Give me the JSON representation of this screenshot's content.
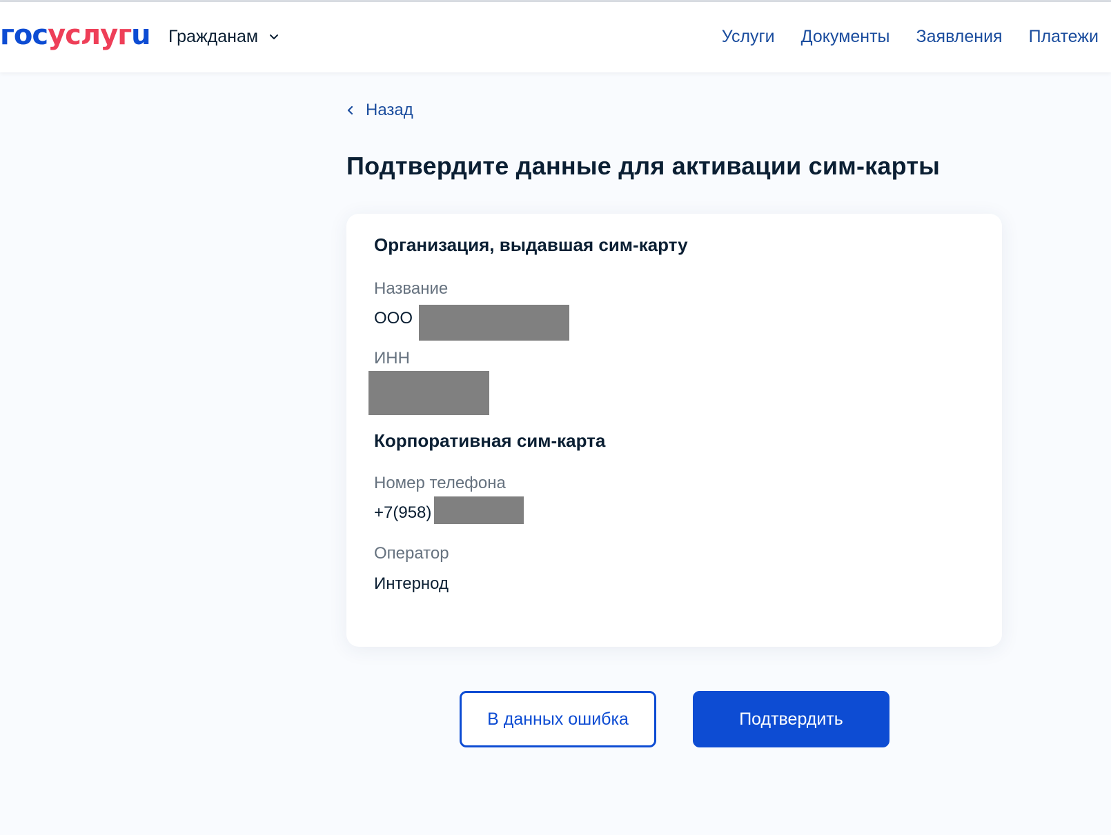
{
  "header": {
    "logo": {
      "part1": "гос",
      "part2": "услуг",
      "part3": "u"
    },
    "audience_menu": {
      "label": "Гражданам"
    },
    "nav": [
      {
        "label": "Услуги"
      },
      {
        "label": "Документы"
      },
      {
        "label": "Заявления"
      },
      {
        "label": "Платежи"
      }
    ]
  },
  "back_link": {
    "label": "Назад"
  },
  "page_title": "Подтвердите данные для активации сим-карты",
  "card": {
    "org_section": {
      "title": "Организация, выдавшая сим-карту",
      "name_label": "Название",
      "name_value": "ООО",
      "inn_label": "ИНН",
      "inn_value": ""
    },
    "sim_section": {
      "title": "Корпоративная сим-карта",
      "phone_label": "Номер телефона",
      "phone_value": "+7(958)",
      "operator_label": "Оператор",
      "operator_value": "Интернод"
    }
  },
  "actions": {
    "secondary_label": "В данных ошибка",
    "primary_label": "Подтвердить"
  },
  "colors": {
    "accent": "#0d4cd3",
    "logo_red": "#ee3f58",
    "text_primary": "#0b1f33",
    "text_secondary": "#66727f",
    "page_background": "#f9fbfe"
  },
  "icons": {
    "audience_menu": "chevron-down-icon",
    "back": "chevron-left-icon"
  }
}
